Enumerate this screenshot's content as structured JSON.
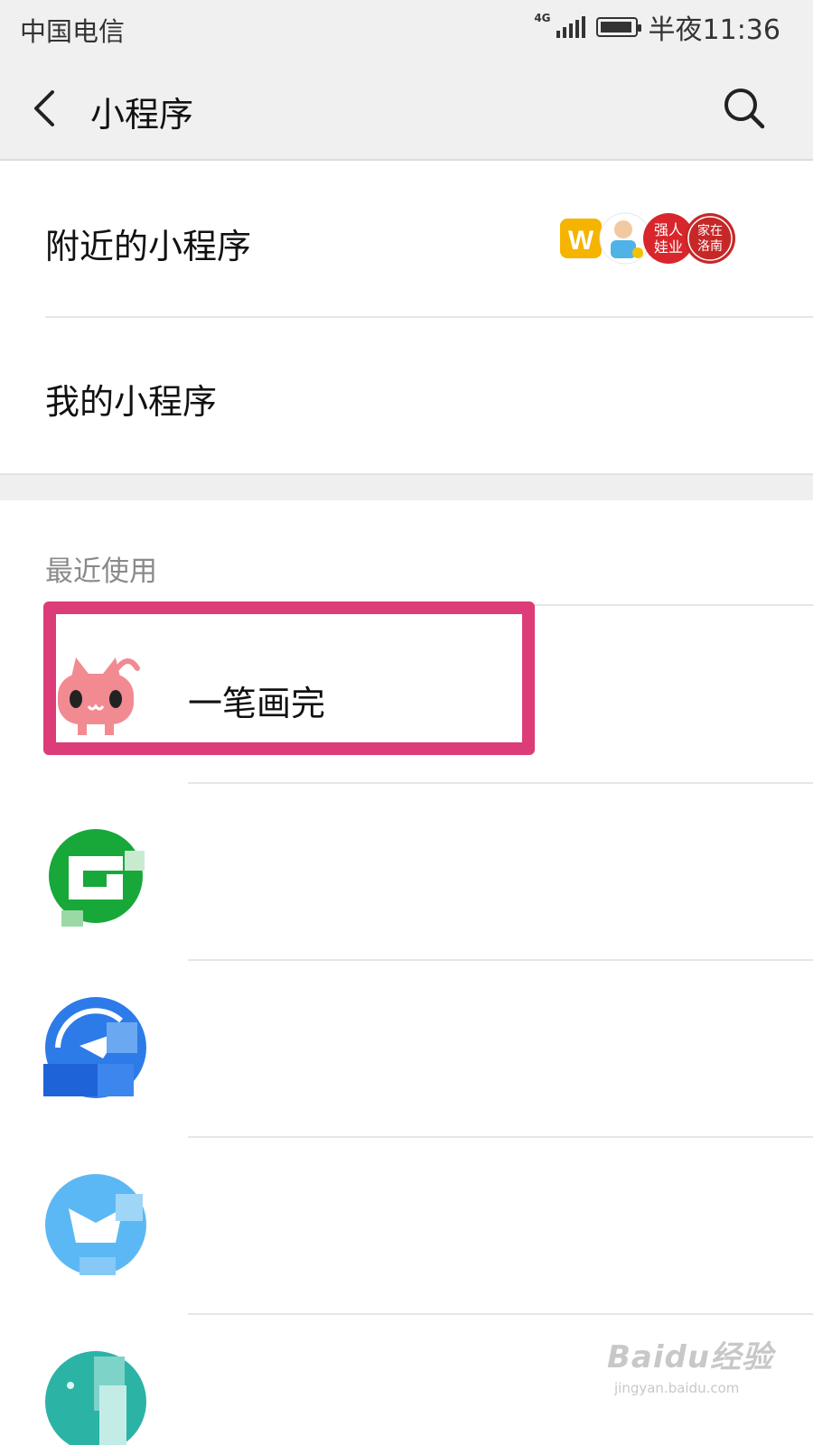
{
  "status_bar": {
    "carrier": "中国电信",
    "network": "4G",
    "time": "半夜11:36"
  },
  "nav": {
    "title": "小程序",
    "back_icon": "chevron-left-icon",
    "search_icon": "search-icon"
  },
  "entries": {
    "nearby": "附近的小程序",
    "mine": "我的小程序"
  },
  "nearby_logo_text": {
    "logo1": "W",
    "logo3_line1": "强人",
    "logo3_line2": "娃业",
    "logo4_line1": "家在",
    "logo4_line2": "洛南"
  },
  "recent": {
    "label": "最近使用",
    "items": [
      {
        "name": "一笔画完",
        "icon": "pink-cat-icon"
      },
      {
        "name": "",
        "icon": "green-g-icon"
      },
      {
        "name": "",
        "icon": "blue-plane-icon"
      },
      {
        "name": "",
        "icon": "lightblue-bird-icon"
      },
      {
        "name": "",
        "icon": "teal-leaf-icon"
      }
    ]
  },
  "watermark": {
    "main": "Baidu经验",
    "sub": "jingyan.baidu.com"
  },
  "colors": {
    "highlight_border": "#dc3c78",
    "header_bg": "#f0f0f0"
  }
}
